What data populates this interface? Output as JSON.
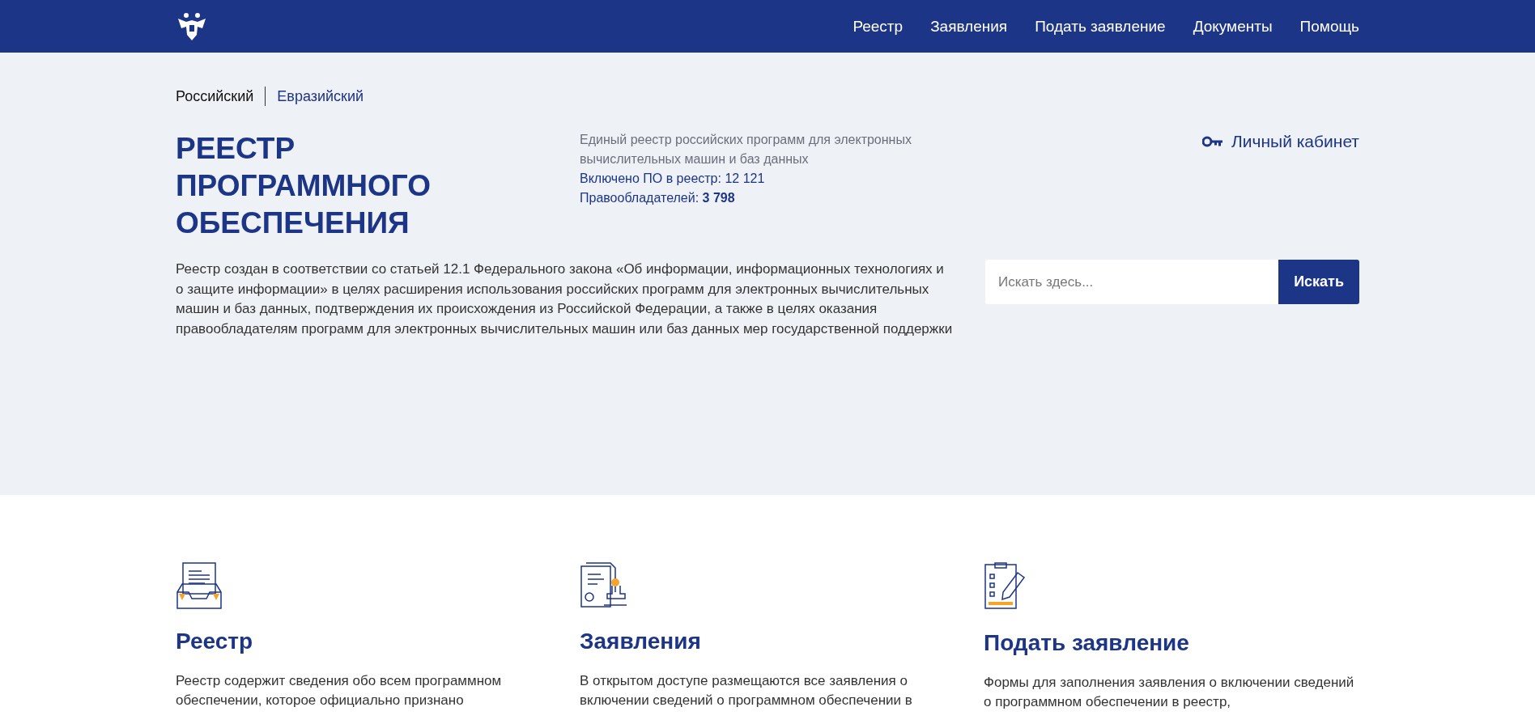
{
  "header": {
    "nav": [
      "Реестр",
      "Заявления",
      "Подать заявление",
      "Документы",
      "Помощь"
    ]
  },
  "registry_tabs": [
    {
      "label": "Российский",
      "selected": true
    },
    {
      "label": "Евразийский",
      "selected": false
    }
  ],
  "hero": {
    "title": "РЕЕСТР ПРОГРАММНОГО ОБЕСПЕЧЕНИЯ",
    "subtitle": "Единый реестр российских программ для электронных вычислительных машин и баз данных",
    "stats": [
      "Включено ПО в реестр: 12 121",
      "Правообладателей: **3 798**"
    ],
    "description": "Реестр создан в соответствии со статьей 12.1 Федерального закона «Об информации, информационных технологиях и о защите информации» в целях расширения использования российских программ для электронных вычислительных машин и баз данных, подтверждения их происхождения из Российской Федерации, а также в целях оказания правообладателям программ для электронных вычислительных машин или баз данных мер государственной поддержки",
    "account_link": "Личный кабинет",
    "search": {
      "placeholder": "Искать здесь...",
      "button": "Искать"
    }
  },
  "cards": [
    {
      "kind": "registry",
      "title": "Реестр",
      "text": "Реестр содержит сведения обо всем программном обеспечении, которое официально признано"
    },
    {
      "kind": "applications",
      "title": "Заявления",
      "text": "В открытом доступе размещаются все заявления о включении сведений о программном обеспечении в"
    },
    {
      "kind": "submit",
      "title": "Подать заявление",
      "text": "Формы для заполнения заявления о включении сведений о программном обеспечении в реестр,"
    }
  ]
}
